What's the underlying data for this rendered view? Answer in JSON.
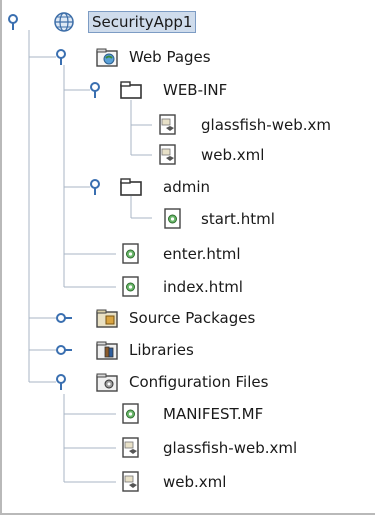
{
  "tree": {
    "root": {
      "label": "SecurityApp1",
      "expanded": true,
      "selected": true
    },
    "web_pages": {
      "label": "Web Pages",
      "expanded": true,
      "web_inf": {
        "label": "WEB-INF",
        "expanded": true,
        "files": [
          "glassfish-web.xm",
          "web.xml"
        ]
      },
      "admin": {
        "label": "admin",
        "expanded": true,
        "files": [
          "start.html"
        ]
      },
      "files": [
        "enter.html",
        "index.html"
      ]
    },
    "source_packages": {
      "label": "Source Packages",
      "expanded": false
    },
    "libraries": {
      "label": "Libraries",
      "expanded": false
    },
    "configuration_files": {
      "label": "Configuration Files",
      "expanded": true,
      "files": [
        "MANIFEST.MF",
        "glassfish-web.xml",
        "web.xml"
      ]
    }
  },
  "icons": {
    "project": "globe-icon",
    "web_pages": "web-pages-folder-icon",
    "folder": "folder-icon",
    "xml": "xml-file-icon",
    "html": "html-file-icon",
    "source_packages": "source-packages-icon",
    "libraries": "libraries-icon",
    "config": "configuration-files-icon"
  },
  "colors": {
    "selection_bg": "#cfdcec",
    "selection_border": "#7d9cc4",
    "tree_line": "#a9b6c6",
    "toggle": "#3a6fb0"
  }
}
